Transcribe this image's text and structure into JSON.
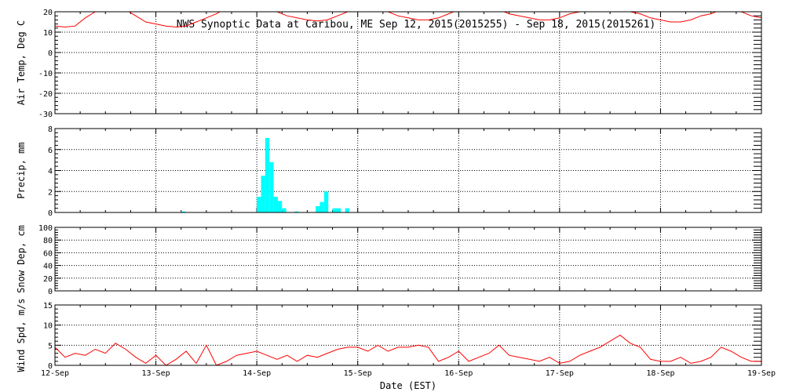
{
  "title": "NWS Synoptic Data at Caribou, ME   Sep 12, 2015(2015255) - Sep 18, 2015(2015261)",
  "chart_data": [
    {
      "type": "line",
      "name": "air_temp",
      "ylabel": "Air Temp, Deg C",
      "ylim": [
        -30,
        20
      ],
      "yticks": [
        "-30",
        "-20",
        "-10",
        "0",
        "10",
        "20"
      ],
      "line_color": "#ff0000",
      "x_days": [
        0,
        0.1,
        0.2,
        0.3,
        0.4,
        0.5,
        0.6,
        0.7,
        0.8,
        0.9,
        1.0,
        1.1,
        1.2,
        1.3,
        1.4,
        1.5,
        1.6,
        1.7,
        1.8,
        1.9,
        2.0,
        2.1,
        2.2,
        2.3,
        2.4,
        2.5,
        2.6,
        2.7,
        2.8,
        2.9,
        3.0,
        3.1,
        3.2,
        3.3,
        3.4,
        3.5,
        3.6,
        3.7,
        3.8,
        3.9,
        4.0,
        4.1,
        4.2,
        4.3,
        4.4,
        4.5,
        4.6,
        4.7,
        4.8,
        4.9,
        5.0,
        5.1,
        5.2,
        5.3,
        5.4,
        5.5,
        5.6,
        5.7,
        5.8,
        5.9,
        6.0,
        6.1,
        6.2,
        6.3,
        6.4,
        6.5,
        6.6,
        6.7,
        6.8,
        6.9,
        7.0
      ],
      "values": [
        13,
        12.5,
        13,
        17,
        20,
        21,
        22,
        21,
        18,
        15,
        14,
        13,
        12.5,
        13,
        15,
        17,
        19,
        22,
        24,
        25,
        24,
        22,
        20,
        18,
        17,
        16,
        15.5,
        16,
        18,
        20,
        22,
        22,
        21,
        20,
        18,
        17,
        16,
        16,
        17,
        19,
        21,
        23,
        24,
        23,
        21,
        19,
        18,
        17,
        16,
        16,
        17,
        19,
        20,
        21,
        21,
        20,
        20,
        20,
        19,
        17,
        16,
        15,
        15,
        16,
        18,
        19,
        21,
        21,
        20,
        18,
        17
      ]
    },
    {
      "type": "bar",
      "name": "precip",
      "ylabel": "Precip, mm",
      "ylim": [
        0,
        8
      ],
      "yticks": [
        "0",
        "2",
        "4",
        "6",
        "8"
      ],
      "bar_color": "#00ffff",
      "bar_width_days": 0.041667,
      "x_days": [
        1.25,
        2.0,
        2.042,
        2.083,
        2.125,
        2.167,
        2.208,
        2.25,
        2.375,
        2.583,
        2.625,
        2.667,
        2.75,
        2.792,
        2.875
      ],
      "values": [
        0.1,
        1.5,
        3.5,
        7.1,
        4.8,
        1.5,
        1.1,
        0.4,
        0.1,
        0.6,
        1.0,
        2.0,
        0.4,
        0.4,
        0.4
      ]
    },
    {
      "type": "line",
      "name": "snow_depth",
      "ylabel": "Snow Dep, cm",
      "ylim": [
        0,
        100
      ],
      "yticks": [
        "0",
        "20",
        "40",
        "60",
        "80",
        "100"
      ],
      "x_days": [],
      "values": []
    },
    {
      "type": "line",
      "name": "wind_speed",
      "ylabel": "Wind Spd, m/s",
      "xlabel": "Date (EST)",
      "ylim": [
        0,
        15
      ],
      "yticks": [
        "0",
        "5",
        "10",
        "15"
      ],
      "line_color": "#ff0000",
      "x_days": [
        0,
        0.1,
        0.2,
        0.3,
        0.4,
        0.5,
        0.6,
        0.7,
        0.8,
        0.9,
        1.0,
        1.1,
        1.2,
        1.3,
        1.4,
        1.5,
        1.6,
        1.7,
        1.8,
        1.9,
        2.0,
        2.1,
        2.2,
        2.3,
        2.4,
        2.5,
        2.6,
        2.7,
        2.8,
        2.9,
        3.0,
        3.1,
        3.2,
        3.3,
        3.4,
        3.5,
        3.6,
        3.7,
        3.8,
        3.9,
        4.0,
        4.1,
        4.2,
        4.3,
        4.4,
        4.5,
        4.6,
        4.7,
        4.8,
        4.9,
        5.0,
        5.1,
        5.2,
        5.3,
        5.4,
        5.5,
        5.6,
        5.7,
        5.8,
        5.9,
        6.0,
        6.1,
        6.2,
        6.3,
        6.4,
        6.5,
        6.6,
        6.7,
        6.8,
        6.9,
        7.0
      ],
      "values": [
        4.5,
        2,
        3,
        2.5,
        4,
        3,
        5.5,
        4,
        2,
        0.5,
        2.5,
        0,
        1.5,
        3.5,
        0.5,
        5,
        0,
        1,
        2.5,
        3,
        3.5,
        2.5,
        1.5,
        2.5,
        1,
        2.5,
        2,
        3,
        4,
        4.5,
        4.5,
        3.5,
        5,
        3.5,
        4.5,
        4.5,
        5,
        4.5,
        1,
        2,
        3.5,
        1,
        2,
        3,
        5,
        2.5,
        2,
        1.5,
        1,
        2,
        0.5,
        1,
        2.5,
        3.5,
        4.5,
        6,
        7.5,
        5.5,
        4.5,
        1.5,
        1,
        1,
        2,
        0.5,
        1,
        2,
        4.5,
        3.5,
        2,
        1,
        1
      ]
    }
  ],
  "x_axis": {
    "label": "Date (EST)",
    "tick_labels": [
      "12-Sep",
      "13-Sep",
      "14-Sep",
      "15-Sep",
      "16-Sep",
      "17-Sep",
      "18-Sep",
      "19-Sep"
    ],
    "xlim_days": [
      0,
      7
    ]
  }
}
